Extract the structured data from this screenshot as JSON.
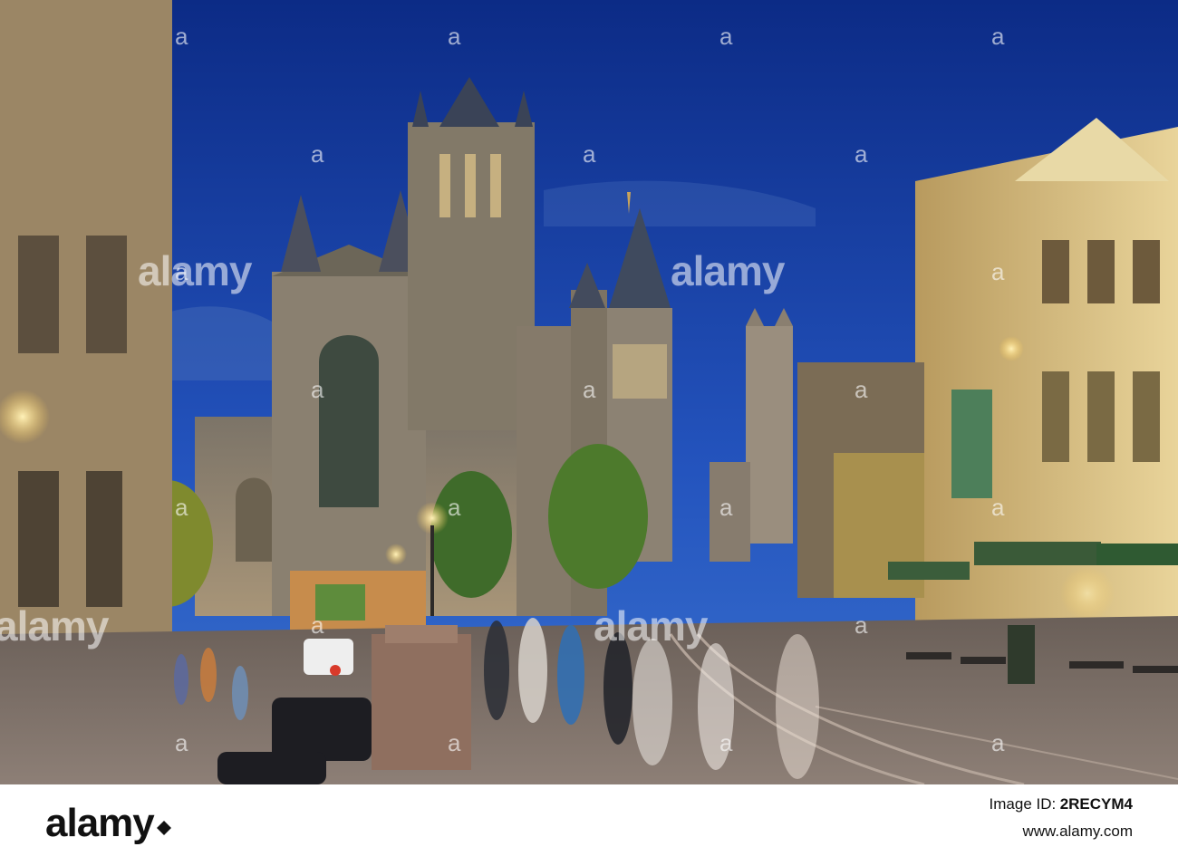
{
  "watermark": {
    "brand": "alamy",
    "brand_mark": "a"
  },
  "footer": {
    "logo_text": "alamy",
    "image_id_label": "Image ID:",
    "image_id": "2RECYM4",
    "url": "www.alamy.com"
  },
  "colors": {
    "sky_top": "#0e2f8c",
    "sky_bottom": "#2c5fc4",
    "stone": "#8a7f70",
    "lamp": "#ffd36b"
  }
}
